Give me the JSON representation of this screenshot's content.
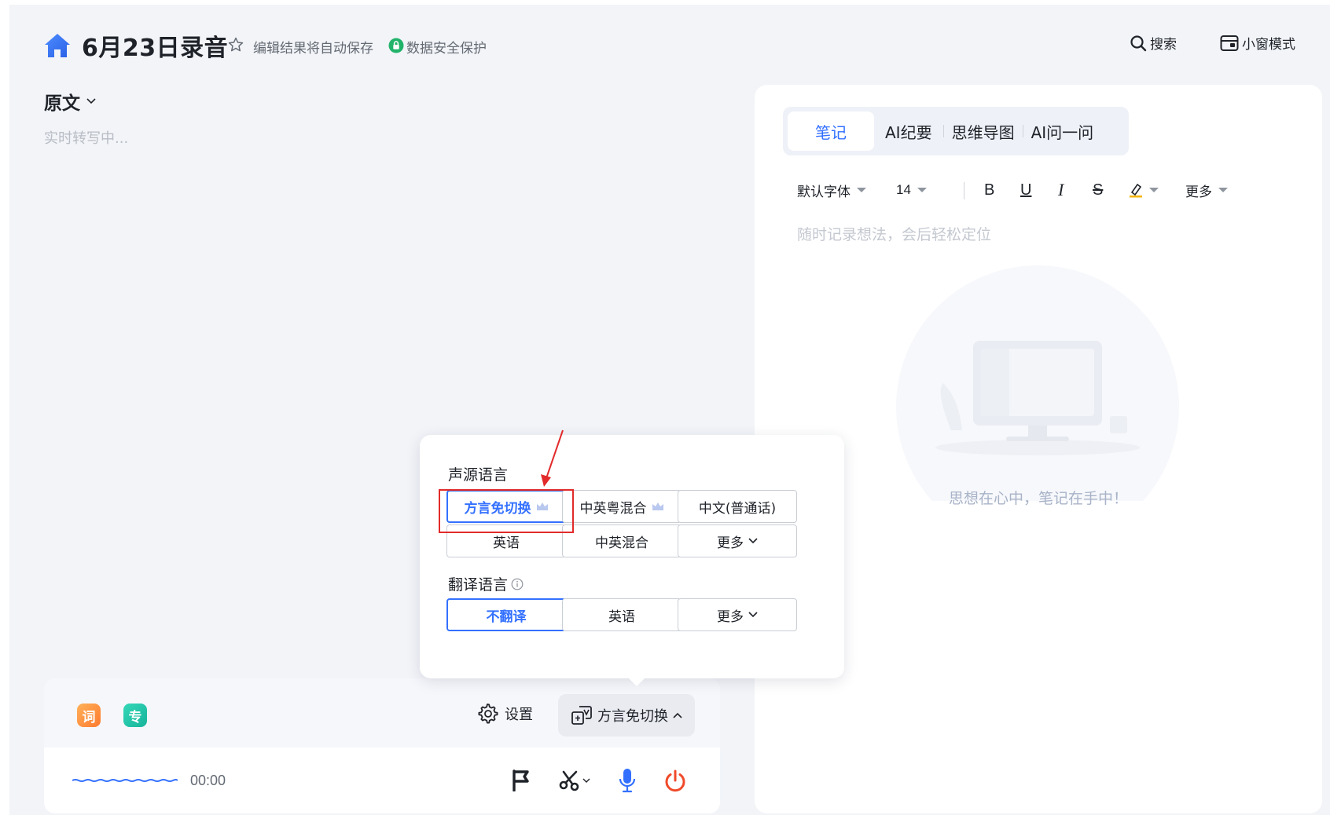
{
  "header": {
    "title": "6月23日录音",
    "autosave_text": "编辑结果将自动保存",
    "safety_text": "数据安全保护",
    "search_label": "搜索",
    "mini_window_label": "小窗模式"
  },
  "transcript": {
    "title": "原文",
    "status": "实时转写中..."
  },
  "control_bar": {
    "badge_ci": "词",
    "badge_zhuan": "专",
    "settings_label": "设置",
    "dialect_label": "方言免切换",
    "timer": "00:00"
  },
  "notes": {
    "tabs": [
      {
        "label": "笔记"
      },
      {
        "label": "AI纪要"
      },
      {
        "label": "思维导图"
      },
      {
        "label": "AI问一问"
      }
    ],
    "toolbar": {
      "font": "默认字体",
      "size": "14",
      "bold": "B",
      "underline": "U",
      "italic": "I",
      "strike": "S",
      "more": "更多"
    },
    "placeholder": "随时记录想法，会后轻松定位",
    "empty_text": "思想在心中，笔记在手中！"
  },
  "popup": {
    "source_title": "声源语言",
    "source_options": [
      {
        "label": "方言免切换",
        "crown": true,
        "selected": true
      },
      {
        "label": "中英粤混合",
        "crown": true,
        "selected": false
      },
      {
        "label": "中文(普通话)",
        "crown": false,
        "selected": false
      },
      {
        "label": "英语",
        "crown": false,
        "selected": false
      },
      {
        "label": "中英混合",
        "crown": false,
        "selected": false
      },
      {
        "label": "更多",
        "crown": false,
        "selected": false
      }
    ],
    "translate_title": "翻译语言",
    "translate_options": [
      {
        "label": "不翻译",
        "selected": true
      },
      {
        "label": "英语",
        "selected": false
      },
      {
        "label": "更多",
        "selected": false
      }
    ]
  },
  "colors": {
    "accent": "#3370ff",
    "highlight_box": "#e22a2a",
    "power": "#f04a2a"
  },
  "icons": [
    "home-icon",
    "star-icon",
    "shield-icon",
    "search-icon",
    "mini-window-icon",
    "chevron-down-icon",
    "gear-icon",
    "dialect-switch-icon",
    "flag-icon",
    "scissors-icon",
    "mic-icon",
    "power-icon",
    "crown-icon",
    "info-icon",
    "highlighter-icon"
  ]
}
